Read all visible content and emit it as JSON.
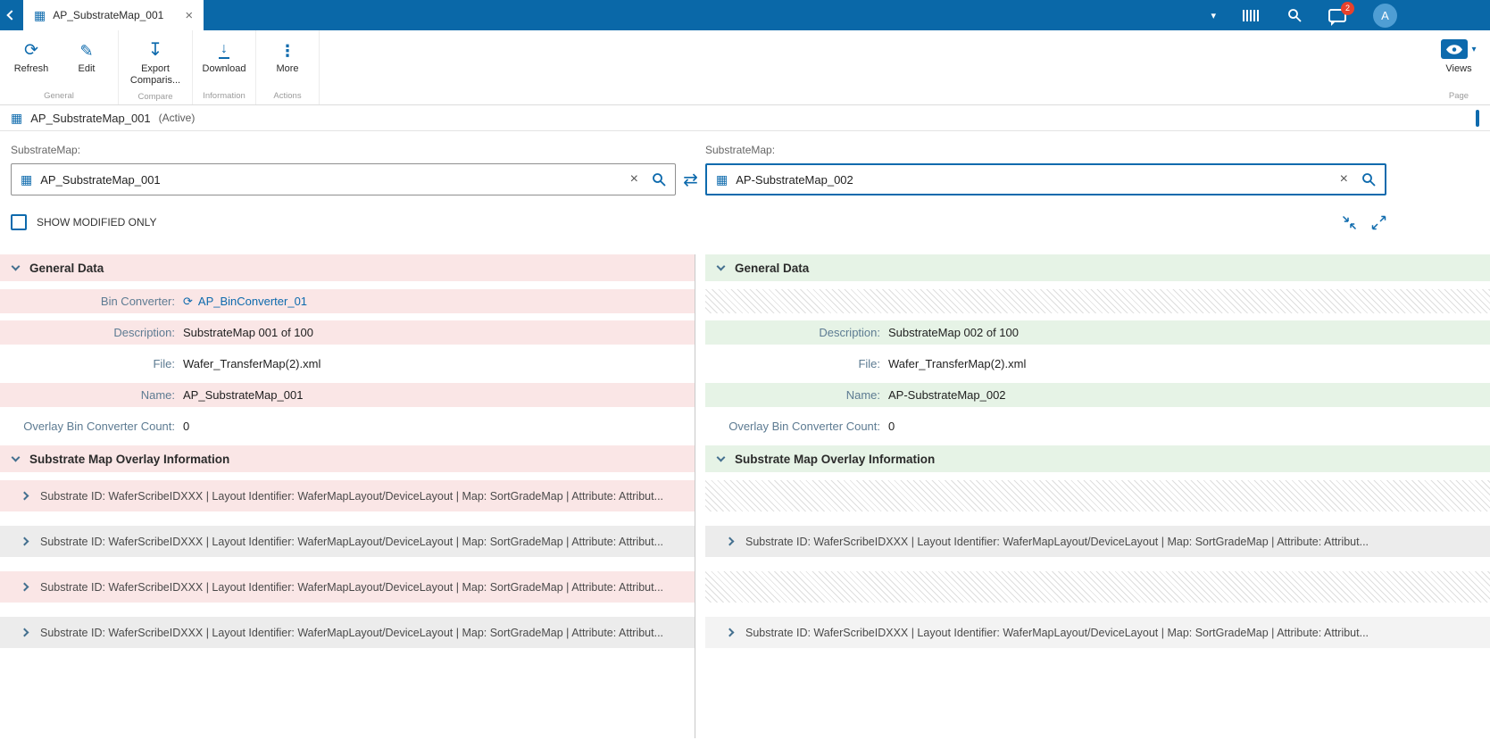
{
  "colors": {
    "topbar": "#0a68a8",
    "accent": "#0d6aad",
    "diff_left": "#fae6e6",
    "diff_right": "#e6f3e6",
    "badge": "#e8412c"
  },
  "icons": {
    "grid": "▦",
    "close": "×",
    "caret": "▾",
    "refresh": "⟳",
    "edit": "✎",
    "export": "↧",
    "download": "↓",
    "more": "⋮",
    "swap": "⇄",
    "sync": "⟳",
    "clear": "×"
  },
  "topbar": {
    "tab_title": "AP_SubstrateMap_001",
    "chat_badge": "2",
    "avatar_initial": "A"
  },
  "ribbon": {
    "buttons": {
      "refresh": "Refresh",
      "edit": "Edit",
      "export_comparison": "Export Comparis...",
      "download": "Download",
      "more": "More",
      "views": "Views"
    },
    "groups": {
      "general": "General",
      "compare": "Compare",
      "information": "Information",
      "actions": "Actions",
      "page": "Page"
    }
  },
  "titlebar": {
    "title": "AP_SubstrateMap_001",
    "status": "(Active)"
  },
  "selector": {
    "left_label": "SubstrateMap:",
    "right_label": "SubstrateMap:",
    "left_value": "AP_SubstrateMap_001",
    "right_value": "AP-SubstrateMap_002",
    "show_modified_label": "SHOW MODIFIED ONLY"
  },
  "panels": {
    "overlay_row_text": "Substrate ID: WaferScribeIDXXX | Layout Identifier: WaferMapLayout/DeviceLayout | Map: SortGradeMap | Attribute: Attribut...",
    "left": {
      "general_header": "General Data",
      "overlay_header": "Substrate Map Overlay Information",
      "fields": [
        {
          "label": "Bin Converter:",
          "value": "AP_BinConverter_01"
        },
        {
          "label": "Description:",
          "value": "SubstrateMap 001 of 100"
        },
        {
          "label": "File:",
          "value": "Wafer_TransferMap(2).xml"
        },
        {
          "label": "Name:",
          "value": "AP_SubstrateMap_001"
        },
        {
          "label": "Overlay Bin Converter Count:",
          "value": "0"
        }
      ]
    },
    "right": {
      "general_header": "General Data",
      "overlay_header": "Substrate Map Overlay Information",
      "fields": [
        {
          "label": "Description:",
          "value": "SubstrateMap 002 of 100"
        },
        {
          "label": "File:",
          "value": "Wafer_TransferMap(2).xml"
        },
        {
          "label": "Name:",
          "value": "AP-SubstrateMap_002"
        },
        {
          "label": "Overlay Bin Converter Count:",
          "value": "0"
        }
      ]
    }
  }
}
